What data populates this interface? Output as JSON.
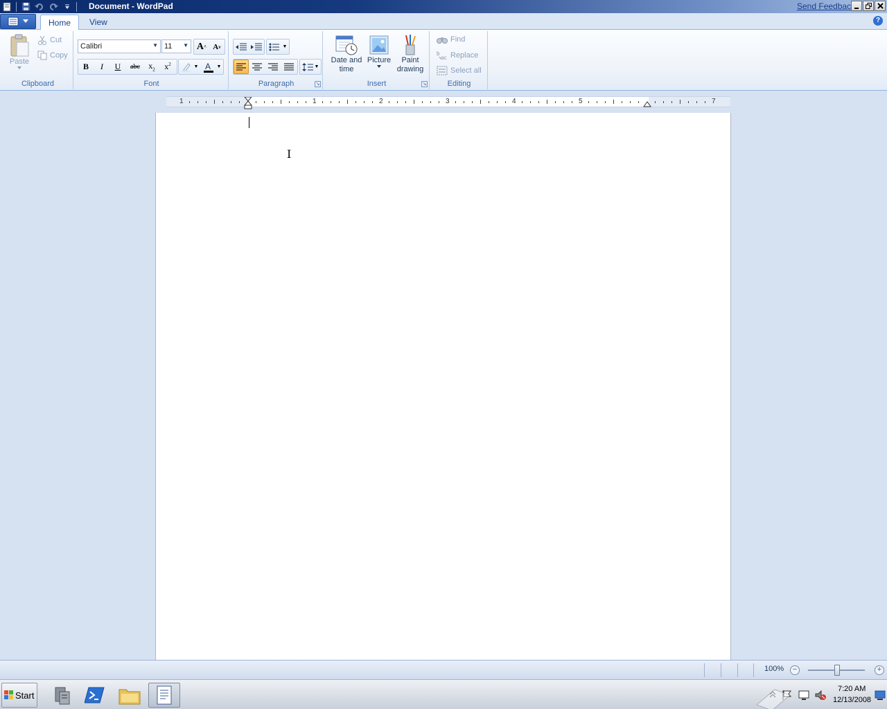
{
  "window": {
    "title": "Document - WordPad",
    "send_feedback": "Send Feedback",
    "controls": [
      "minimize",
      "restore",
      "close"
    ]
  },
  "ribbon_tabs": [
    {
      "label": "Home",
      "active": true
    },
    {
      "label": "View",
      "active": false
    }
  ],
  "clipboard": {
    "paste": "Paste",
    "cut": "Cut",
    "copy": "Copy",
    "label": "Clipboard"
  },
  "font": {
    "family": "Calibri",
    "size": "11",
    "label": "Font",
    "bold": "B",
    "italic": "I",
    "underline": "U",
    "strike": "abc",
    "grow": "A",
    "shrink": "A"
  },
  "paragraph": {
    "label": "Paragraph",
    "active_alignment": "left"
  },
  "insert": {
    "date_time": "Date and time",
    "picture": "Picture",
    "paint": "Paint drawing",
    "label": "Insert"
  },
  "editing": {
    "find": "Find",
    "replace": "Replace",
    "select_all": "Select all",
    "label": "Editing"
  },
  "ruler": {
    "numbers": [
      "1",
      "1",
      "2",
      "3",
      "4",
      "5",
      "7"
    ]
  },
  "status": {
    "zoom": "100%",
    "zoom_level": 1.0
  },
  "taskbar": {
    "start": "Start",
    "time": "7:20 AM",
    "date": "12/13/2008",
    "active_app": "WordPad"
  },
  "colors": {
    "title_bar_dark": "#0a2a6b",
    "ribbon_bg": "#eef3fa",
    "workspace_bg": "#d6e2f1",
    "pressed": "#ffb84a"
  }
}
